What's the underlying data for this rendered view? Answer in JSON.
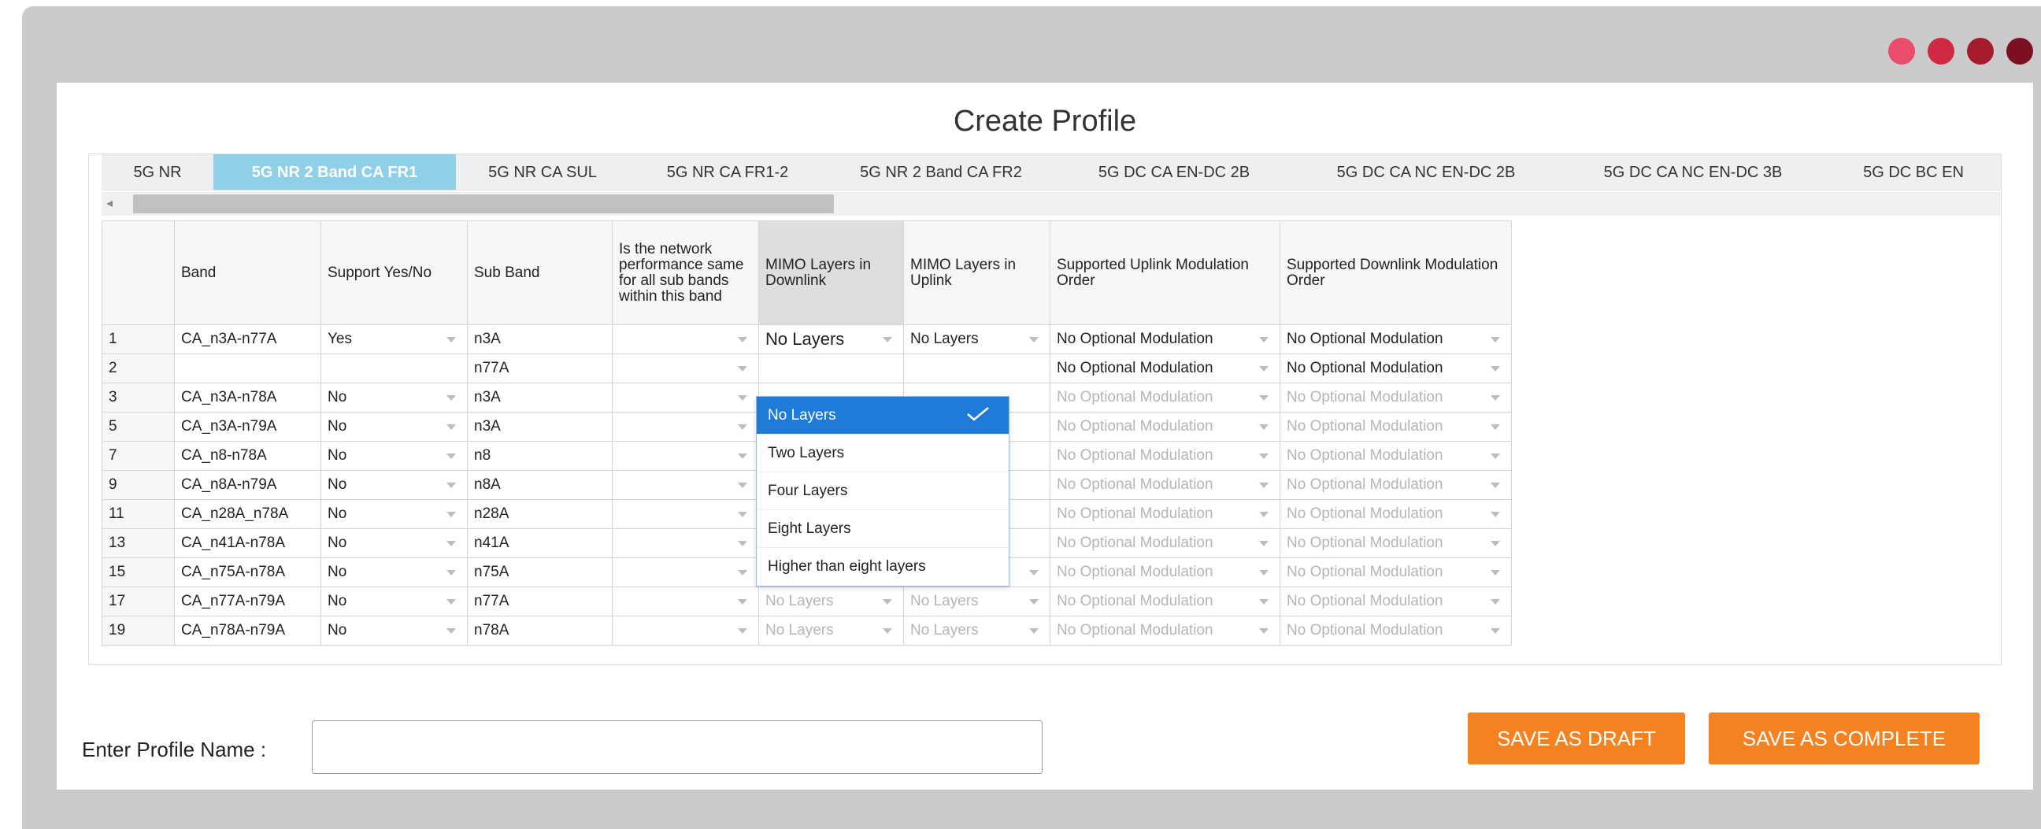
{
  "window": {
    "dot_colors": [
      "#e94d6a",
      "#cf2a44",
      "#a41b2c",
      "#7a1022"
    ]
  },
  "page_title": "Create Profile",
  "tabs": [
    {
      "label": "5G NR"
    },
    {
      "label": "5G NR 2 Band CA FR1",
      "active": true
    },
    {
      "label": "5G NR CA SUL"
    },
    {
      "label": "5G NR CA FR1-2"
    },
    {
      "label": "5G NR 2 Band CA FR2"
    },
    {
      "label": "5G DC CA EN-DC 2B"
    },
    {
      "label": "5G DC CA NC EN-DC 2B"
    },
    {
      "label": "5G DC CA NC EN-DC 3B"
    },
    {
      "label": "5G DC BC EN"
    }
  ],
  "table": {
    "headers": {
      "band": "Band",
      "support": "Support Yes/No",
      "subband": "Sub Band",
      "network": "Is the network performance same for all sub bands within this band",
      "mimo_dl": "MIMO Layers in Downlink",
      "mimo_ul": "MIMO Layers in Uplink",
      "ul_mod": "Supported Uplink Modulation Order",
      "dl_mod": "Supported Downlink Modulation Order"
    },
    "rows": [
      {
        "num": "1",
        "band": "CA_n3A-n77A",
        "support": "Yes",
        "subband": "n3A",
        "mimo_dl": "No Layers",
        "mimo_ul": "No Layers",
        "ul_mod": "No Optional Modulation",
        "dl_mod": "No Optional Modulation"
      },
      {
        "num": "2",
        "band": "",
        "support": "",
        "subband": "n77A",
        "mimo_dl": "",
        "mimo_ul": "",
        "ul_mod": "No Optional Modulation",
        "dl_mod": "No Optional Modulation"
      },
      {
        "num": "3",
        "band": "CA_n3A-n78A",
        "support": "No",
        "subband": "n3A",
        "mimo_dl": "",
        "mimo_ul": "",
        "ul_mod": "No Optional Modulation",
        "dl_mod": "No Optional Modulation"
      },
      {
        "num": "5",
        "band": "CA_n3A-n79A",
        "support": "No",
        "subband": "n3A",
        "mimo_dl": "",
        "mimo_ul": "",
        "ul_mod": "No Optional Modulation",
        "dl_mod": "No Optional Modulation"
      },
      {
        "num": "7",
        "band": "CA_n8-n78A",
        "support": "No",
        "subband": "n8",
        "mimo_dl": "",
        "mimo_ul": "",
        "ul_mod": "No Optional Modulation",
        "dl_mod": "No Optional Modulation"
      },
      {
        "num": "9",
        "band": "CA_n8A-n79A",
        "support": "No",
        "subband": "n8A",
        "mimo_dl": "",
        "mimo_ul": "",
        "ul_mod": "No Optional Modulation",
        "dl_mod": "No Optional Modulation"
      },
      {
        "num": "11",
        "band": "CA_n28A_n78A",
        "support": "No",
        "subband": "n28A",
        "mimo_dl": "",
        "mimo_ul": "",
        "ul_mod": "No Optional Modulation",
        "dl_mod": "No Optional Modulation"
      },
      {
        "num": "13",
        "band": "CA_n41A-n78A",
        "support": "No",
        "subband": "n41A",
        "mimo_dl": "",
        "mimo_ul": "",
        "ul_mod": "No Optional Modulation",
        "dl_mod": "No Optional Modulation"
      },
      {
        "num": "15",
        "band": "CA_n75A-n78A",
        "support": "No",
        "subband": "n75A",
        "mimo_dl": "No Layers",
        "mimo_ul": "No Layers",
        "ul_mod": "No Optional Modulation",
        "dl_mod": "No Optional Modulation"
      },
      {
        "num": "17",
        "band": "CA_n77A-n79A",
        "support": "No",
        "subband": "n77A",
        "mimo_dl": "No Layers",
        "mimo_ul": "No Layers",
        "ul_mod": "No Optional Modulation",
        "dl_mod": "No Optional Modulation"
      },
      {
        "num": "19",
        "band": "CA_n78A-n79A",
        "support": "No",
        "subband": "n78A",
        "mimo_dl": "No Layers",
        "mimo_ul": "No Layers",
        "ul_mod": "No Optional Modulation",
        "dl_mod": "No Optional Modulation"
      }
    ]
  },
  "dropdown": {
    "options": [
      "No Layers",
      "Two Layers",
      "Four Layers",
      "Eight Layers",
      "Higher than eight layers"
    ],
    "selected": "No Layers"
  },
  "footer": {
    "profile_label": "Enter Profile Name :",
    "profile_value": "",
    "save_draft": "SAVE AS DRAFT",
    "save_complete": "SAVE AS COMPLETE"
  }
}
